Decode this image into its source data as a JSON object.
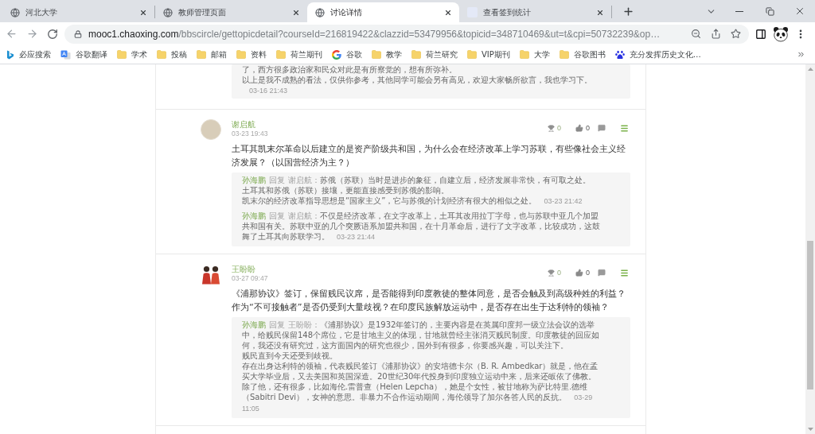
{
  "tabs": [
    {
      "kind": "globe",
      "title": "河北大学",
      "selected": false
    },
    {
      "kind": "globe",
      "title": "教师管理页面",
      "selected": false
    },
    {
      "kind": "globe",
      "title": "讨论详情",
      "selected": true
    },
    {
      "kind": "page",
      "title": "查看签到统计",
      "selected": false
    }
  ],
  "address_bar": {
    "host": "mooc1.chaoxing.com",
    "path": "/bbscircle/gettopicdetail?courseId=216819422&clazzid=53479956&topicid=348710469&ut=t&cpi=50732239&op…"
  },
  "bookmarks": [
    {
      "kind": "bing",
      "label": "必应搜索"
    },
    {
      "kind": "translate",
      "label": "谷歌翻译"
    },
    {
      "kind": "folder",
      "label": "学术"
    },
    {
      "kind": "folder",
      "label": "投稿"
    },
    {
      "kind": "folder",
      "label": "邮箱"
    },
    {
      "kind": "folder",
      "label": "资料"
    },
    {
      "kind": "folder",
      "label": "荷兰期刊"
    },
    {
      "kind": "google",
      "label": "谷歌"
    },
    {
      "kind": "folder",
      "label": "教学"
    },
    {
      "kind": "folder",
      "label": "荷兰研究"
    },
    {
      "kind": "folder",
      "label": "VIP期刊"
    },
    {
      "kind": "folder",
      "label": "大学"
    },
    {
      "kind": "folder",
      "label": "谷歌图书"
    },
    {
      "kind": "baidu",
      "label": "充分发挥历史文化…"
    }
  ],
  "previous_reply": {
    "paragraphs": [
      "了，西方很多政治家和民众对此是有所察觉的，想有所弥补。",
      "以上是我不成熟的看法，仅供你参考，其他同学可能会另有高见，欢迎大家畅所欲言，我也学习下。"
    ],
    "time": "03-16 21:43"
  },
  "posts": [
    {
      "kind": "photo",
      "author": "谢启航",
      "time": "03-23 19:43",
      "award_count": "0",
      "like_count": "0",
      "question": "土耳其凯末尔革命以后建立的是资产阶级共和国，为什么会在经济改革上学习苏联，有些像社会主义经济发展？（以国营经济为主？）",
      "replies": [
        {
          "author": "孙海鹏",
          "action": "回复",
          "target": "谢启航：",
          "paragraphs": [
            "苏俄（苏联）当时是进步的象征，自建立后，经济发展非常快，有可取之处。",
            "土耳其和苏俄（苏联）接壤，更能直接感受到苏俄的影响。",
            "凯末尔的经济改革指导思想是“国家主义”，它与苏俄的计划经济有很大的相似之处。"
          ],
          "time": "03-23 21:42"
        },
        {
          "author": "孙海鹏",
          "action": "回复",
          "target": "谢启航：",
          "paragraphs": [
            "不仅是经济改革，在文字改革上，土耳其改用拉丁字母，也与苏联中亚几个加盟共和国有关。苏联中亚的几个突厥语系加盟共和国，在十月革命后，进行了文字改革，比较成功，这鼓舞了土耳其向苏联学习。"
          ],
          "time": "03-23 21:44"
        }
      ]
    },
    {
      "kind": "cartoon",
      "author": "王盼盼",
      "time": "03-27 09:47",
      "award_count": "0",
      "like_count": "0",
      "question": "《浦那协议》签订，保留贱民议席，是否能得到印度教徒的整体同意，是否会触及到高级种姓的利益？作为“不可接触者”是否仍受到大量歧视？在印度民族解放运动中，是否存在出生于达利特的领袖？",
      "replies": [
        {
          "author": "孙海鹏",
          "action": "回复",
          "target": "王盼盼：",
          "paragraphs": [
            "《浦那协议》是1932年签订的，主要内容是在英属印度邦一级立法会议的选举中，给贱民保留148个席位，它是甘地主义的体现，甘地就曾经主张消灭贱民制度。印度教徒的回应如何，我还没有研究过，这方面国内的研究也很少，国外到有很多，你要感兴趣，可以关注下。",
            "贱民直到今天还受到歧视。",
            "存在出身达利特的领袖，代表贱民签订《浦那协议》的安培德卡尔（B. R. Ambedkar）就是，他在孟买大学毕业后，又去美国和英国深造。20世纪30年代投身到印度独立运动中来，后来还皈依了佛教。除了他，还有很多，比如海伦.雷普查（Helen Lepcha），她是个女性，被甘地称为萨比特里.德维（Sabitri Devi），女神的意思。非暴力不合作运动期间，海伦领导了加尔各答人民的反抗。"
          ],
          "time": "03-29 11:05"
        }
      ]
    }
  ]
}
